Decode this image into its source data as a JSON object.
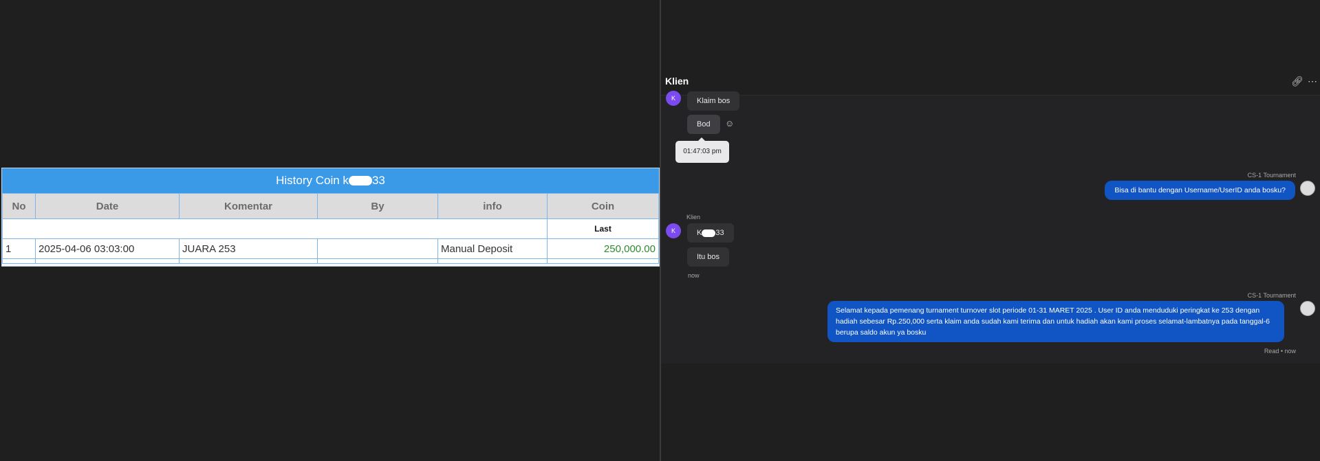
{
  "history": {
    "title_prefix": "History Coin k",
    "title_suffix": "33",
    "columns": [
      "No",
      "Date",
      "Komentar",
      "By",
      "info",
      "Coin"
    ],
    "last_label": "Last",
    "rows": [
      {
        "no": "1",
        "date": "2025-04-06 03:03:00",
        "komentar": "JUARA 253",
        "by": "",
        "info": "Manual Deposit",
        "coin": "250,000.00"
      }
    ]
  },
  "chat": {
    "title": "Klien",
    "icons": {
      "link": "link-icon",
      "more": "more-icon"
    },
    "avatar_initial": "K",
    "messages": {
      "klaim": "Klaim bos",
      "bod": "Bod",
      "tooltip_time": "01:47:03 pm",
      "agent_name_1": "CS-1 Tournament",
      "agent_msg_1": "Bisa di bantu dengan Username/UserID anda bosku?",
      "client_name": "Klien",
      "client_user_prefix": "K",
      "client_user_suffix": "33",
      "itu_bos": "Itu bos",
      "time_now": "now",
      "agent_name_2": "CS-1 Tournament",
      "agent_msg_2": "Selamat kepada pemenang turnament turnover slot periode 01-31 MARET 2025 . User ID anda menduduki peringkat ke 253 dengan hadiah sebesar Rp.250,000 serta klaim anda sudah kami terima dan untuk hadiah akan kami proses selamat-lambatnya pada tanggal-6 berupa saldo akun ya bosku",
      "read_status": "Read • now"
    }
  },
  "colors": {
    "accent": "#3b9ae8",
    "bubble_out": "#1155c5",
    "avatar": "#7b4bf0",
    "coin": "#2e8b2e"
  }
}
